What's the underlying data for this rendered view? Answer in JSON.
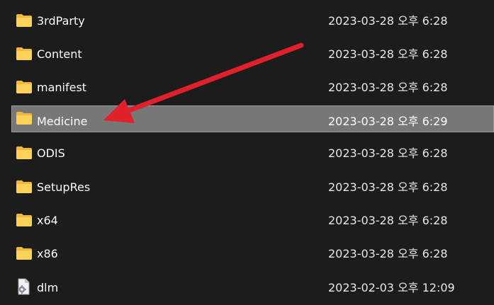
{
  "files": [
    {
      "name": "3rdParty",
      "modified": "2023-03-28 오후 6:28",
      "icon": "folder-icon",
      "selected": false
    },
    {
      "name": "Content",
      "modified": "2023-03-28 오후 6:28",
      "icon": "folder-icon",
      "selected": false
    },
    {
      "name": "manifest",
      "modified": "2023-03-28 오후 6:28",
      "icon": "folder-icon",
      "selected": false
    },
    {
      "name": "Medicine",
      "modified": "2023-03-28 오후 6:29",
      "icon": "folder-icon",
      "selected": true
    },
    {
      "name": "ODIS",
      "modified": "2023-03-28 오후 6:28",
      "icon": "folder-icon",
      "selected": false
    },
    {
      "name": "SetupRes",
      "modified": "2023-03-28 오후 6:28",
      "icon": "folder-icon",
      "selected": false
    },
    {
      "name": "x64",
      "modified": "2023-03-28 오후 6:28",
      "icon": "folder-icon",
      "selected": false
    },
    {
      "name": "x86",
      "modified": "2023-03-28 오후 6:28",
      "icon": "folder-icon",
      "selected": false
    },
    {
      "name": "dlm",
      "modified": "2023-02-03 오후 12:09",
      "icon": "settings-file-icon",
      "selected": false
    }
  ],
  "colors": {
    "background": "#1c1c1c",
    "selection": "#777777",
    "folder": "#f7c948",
    "arrow": "#e0202a"
  },
  "annotation": {
    "type": "arrow",
    "points_to": "Medicine"
  }
}
